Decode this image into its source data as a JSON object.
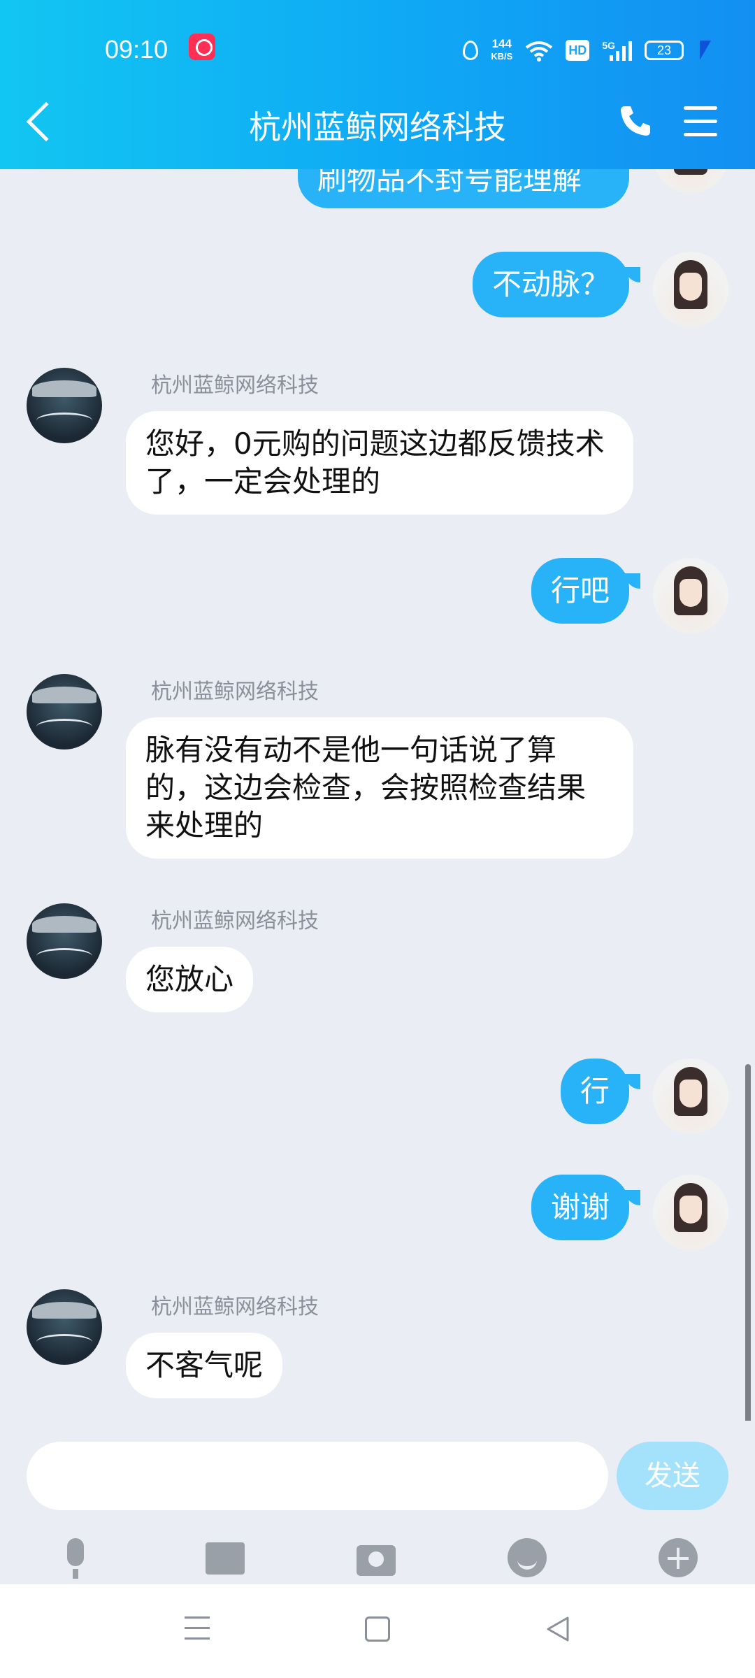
{
  "status_bar": {
    "time": "09:10",
    "net_speed_value": "144",
    "net_speed_unit": "KB/S",
    "hd_label": "HD",
    "signal_label": "5G",
    "battery": "23"
  },
  "header": {
    "title": "杭州蓝鲸网络科技"
  },
  "messages": [
    {
      "from": "me",
      "text": "刷物品不封号能理解"
    },
    {
      "from": "me",
      "text": "不动脉？"
    },
    {
      "from": "them",
      "sender": "杭州蓝鲸网络科技",
      "text": "您好，0元购的问题这边都反馈技术了，一定会处理的"
    },
    {
      "from": "me",
      "text": "行吧"
    },
    {
      "from": "them",
      "sender": "杭州蓝鲸网络科技",
      "text": "脉有没有动不是他一句话说了算的，这边会检查，会按照检查结果来处理的"
    },
    {
      "from": "them",
      "sender": "杭州蓝鲸网络科技",
      "text": "您放心"
    },
    {
      "from": "me",
      "text": "行"
    },
    {
      "from": "me",
      "text": "谢谢"
    },
    {
      "from": "them",
      "sender": "杭州蓝鲸网络科技",
      "text": "不客气呢"
    }
  ],
  "composer": {
    "input_value": "",
    "send_label": "发送"
  },
  "colors": {
    "accent": "#28b2f7",
    "header_start": "#12c6f2",
    "header_end": "#138ff2"
  }
}
